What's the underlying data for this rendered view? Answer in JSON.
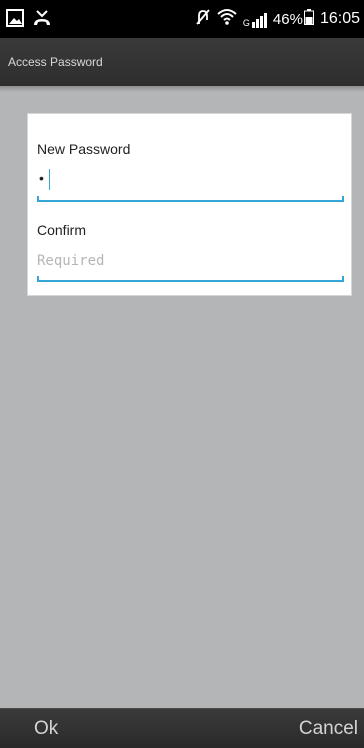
{
  "status_bar": {
    "battery_percent": "46%",
    "time": "16:05",
    "network_label": "G",
    "icons": [
      "gallery-icon",
      "missed-call-icon",
      "mute-icon",
      "wifi-icon",
      "signal-icon",
      "battery-icon"
    ]
  },
  "title_bar": {
    "title": "Access Password"
  },
  "dialog": {
    "new_password": {
      "label": "New Password",
      "value": "•"
    },
    "confirm": {
      "label": "Confirm",
      "placeholder": "Required",
      "value": ""
    }
  },
  "buttons": {
    "ok": "Ok",
    "cancel": "Cancel"
  },
  "colors": {
    "accent": "#33a6d6",
    "background": "#b3b5b7",
    "status_bar": "#000000",
    "title_bar": "#333333"
  }
}
